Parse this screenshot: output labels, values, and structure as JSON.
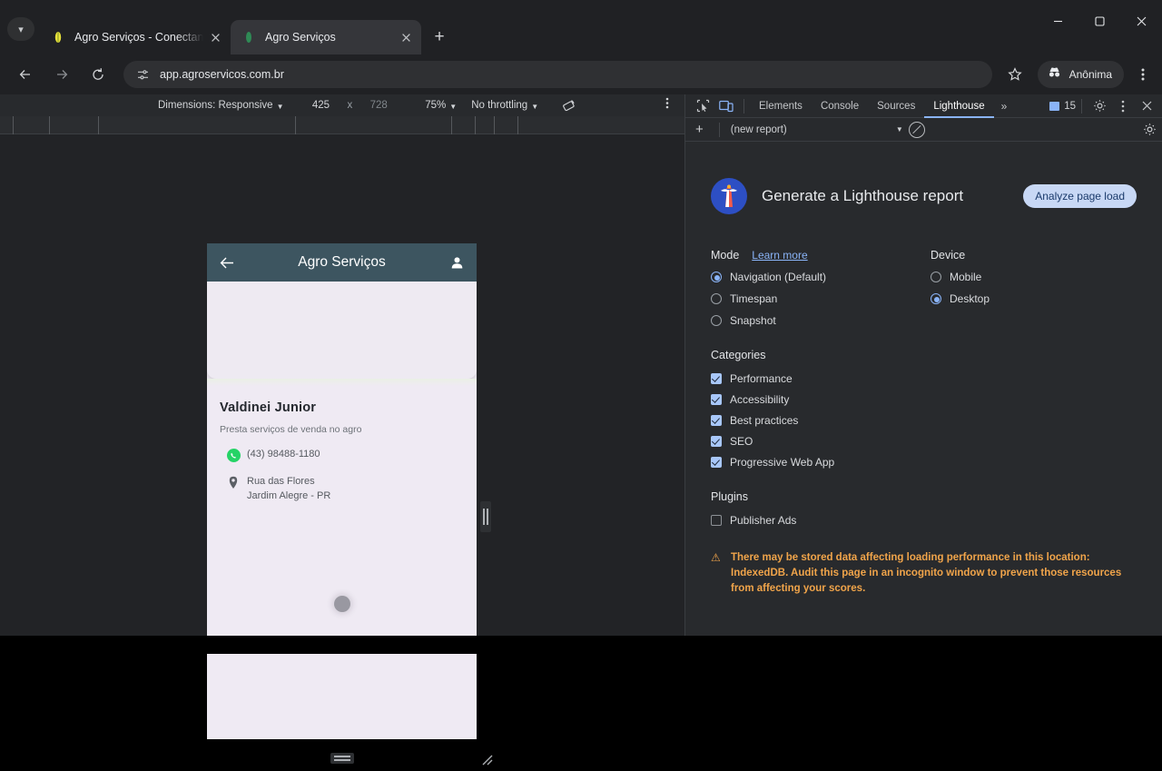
{
  "browser": {
    "tabs": [
      {
        "title": "Agro Serviços - Conectando Pro",
        "favicon": "corn-yellow-icon",
        "active": false
      },
      {
        "title": "Agro Serviços",
        "favicon": "corn-green-icon",
        "active": true
      }
    ],
    "tab_list_icon": "chevron-down-icon",
    "new_tab_icon": "plus-icon",
    "window_controls": {
      "minimize": "minimize-icon",
      "maximize": "maximize-icon",
      "close": "close-icon"
    },
    "nav": {
      "back": "back-arrow-icon",
      "forward": "forward-arrow-icon",
      "reload": "reload-icon"
    },
    "omnibox": {
      "site_settings_icon": "site-settings-icon",
      "url": "app.agroservicos.com.br"
    },
    "bookmark_icon": "star-icon",
    "incognito": {
      "icon": "incognito-icon",
      "label": "Anônima"
    },
    "menu_icon": "kebab-menu-icon"
  },
  "device_toolbar": {
    "dimensions_label": "Dimensions: Responsive",
    "width": "425",
    "times": "x",
    "height": "728",
    "zoom": "75%",
    "throttling": "No throttling",
    "rotate_icon": "rotate-device-icon",
    "more_icon": "kebab-menu-icon"
  },
  "app": {
    "header": {
      "back_icon": "back-arrow-icon",
      "title": "Agro Serviços",
      "account_icon": "person-icon"
    },
    "contact": {
      "name": "Valdinei Junior",
      "tagline": "Presta serviços de venda no agro",
      "phone": "(43) 98488-1180",
      "phone_icon": "whatsapp-icon",
      "address_icon": "location-pin-icon",
      "address_line1": "Rua das Flores",
      "address_line2": "Jardim Alegre  - PR"
    },
    "loading_icon": "spinner-icon"
  },
  "resize": {
    "vertical_handle": "resize-width-handle",
    "horizontal_handle": "resize-height-handle",
    "corner_handle": "resize-corner-handle"
  },
  "devtools": {
    "inspect_icon": "inspect-element-icon",
    "device_toggle_icon": "device-toolbar-icon",
    "tabs": [
      {
        "label": "Elements",
        "active": false
      },
      {
        "label": "Console",
        "active": false
      },
      {
        "label": "Sources",
        "active": false
      },
      {
        "label": "Lighthouse",
        "active": true
      }
    ],
    "more_tabs_icon": "chevron-right-icon",
    "messages_count": "15",
    "messages_icon": "message-icon",
    "settings_icon": "gear-icon",
    "dock_icon": "kebab-menu-icon",
    "close_icon": "close-icon"
  },
  "lighthouse": {
    "toolbar": {
      "add_icon": "plus-icon",
      "report_select": "(new report)",
      "select_caret": "chevron-down-icon",
      "clear_icon": "clear-icon",
      "settings_icon": "gear-icon"
    },
    "logo_icon": "lighthouse-logo-icon",
    "title": "Generate a Lighthouse report",
    "analyze_button": "Analyze page load",
    "mode": {
      "title": "Mode",
      "learn_more": "Learn more",
      "options": [
        {
          "label": "Navigation (Default)",
          "selected": true
        },
        {
          "label": "Timespan",
          "selected": false
        },
        {
          "label": "Snapshot",
          "selected": false
        }
      ]
    },
    "device": {
      "title": "Device",
      "options": [
        {
          "label": "Mobile",
          "selected": false
        },
        {
          "label": "Desktop",
          "selected": true
        }
      ]
    },
    "categories": {
      "title": "Categories",
      "items": [
        {
          "label": "Performance",
          "checked": true
        },
        {
          "label": "Accessibility",
          "checked": true
        },
        {
          "label": "Best practices",
          "checked": true
        },
        {
          "label": "SEO",
          "checked": true
        },
        {
          "label": "Progressive Web App",
          "checked": true
        }
      ]
    },
    "plugins": {
      "title": "Plugins",
      "items": [
        {
          "label": "Publisher Ads",
          "checked": false
        }
      ]
    },
    "warning": {
      "icon": "warning-triangle-icon",
      "text": "There may be stored data affecting loading performance in this location: IndexedDB. Audit this page in an incognito window to prevent those resources from affecting your scores."
    }
  },
  "colors": {
    "accent_blue": "#8ab4f8",
    "warning_orange": "#f0a44a",
    "app_header": "#3d5560",
    "whatsapp_green": "#25d366"
  }
}
